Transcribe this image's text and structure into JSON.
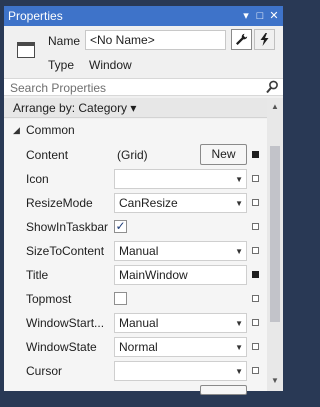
{
  "window": {
    "title": "Properties",
    "buttons": {
      "dropdown": "▾",
      "maximize": "□",
      "close": "✕"
    }
  },
  "header": {
    "name_label": "Name",
    "name_value": "<No Name>",
    "type_label": "Type",
    "type_value": "Window",
    "properties_button_icon": "wrench-icon",
    "events_button_icon": "lightning-icon"
  },
  "search": {
    "placeholder": "Search Properties"
  },
  "arrange": {
    "label": "Arrange by: Category ▾"
  },
  "category": {
    "label": "Common"
  },
  "properties": {
    "content": {
      "name": "Content",
      "value": "(Grid)",
      "button": "New"
    },
    "icon": {
      "name": "Icon",
      "value": ""
    },
    "resize_mode": {
      "name": "ResizeMode",
      "value": "CanResize"
    },
    "show_in_taskbar": {
      "name": "ShowInTaskbar",
      "checked": "✓"
    },
    "size_to_content": {
      "name": "SizeToContent",
      "value": "Manual"
    },
    "title": {
      "name": "Title",
      "value": "MainWindow"
    },
    "topmost": {
      "name": "Topmost",
      "checked": ""
    },
    "window_start": {
      "name": "WindowStart...",
      "value": "Manual"
    },
    "window_state": {
      "name": "WindowState",
      "value": "Normal"
    },
    "cursor": {
      "name": "Cursor",
      "value": ""
    }
  },
  "colors": {
    "title_bar": "#293955",
    "title_tab": "#3e73c9",
    "panel_bg": "#f0f0f0"
  }
}
